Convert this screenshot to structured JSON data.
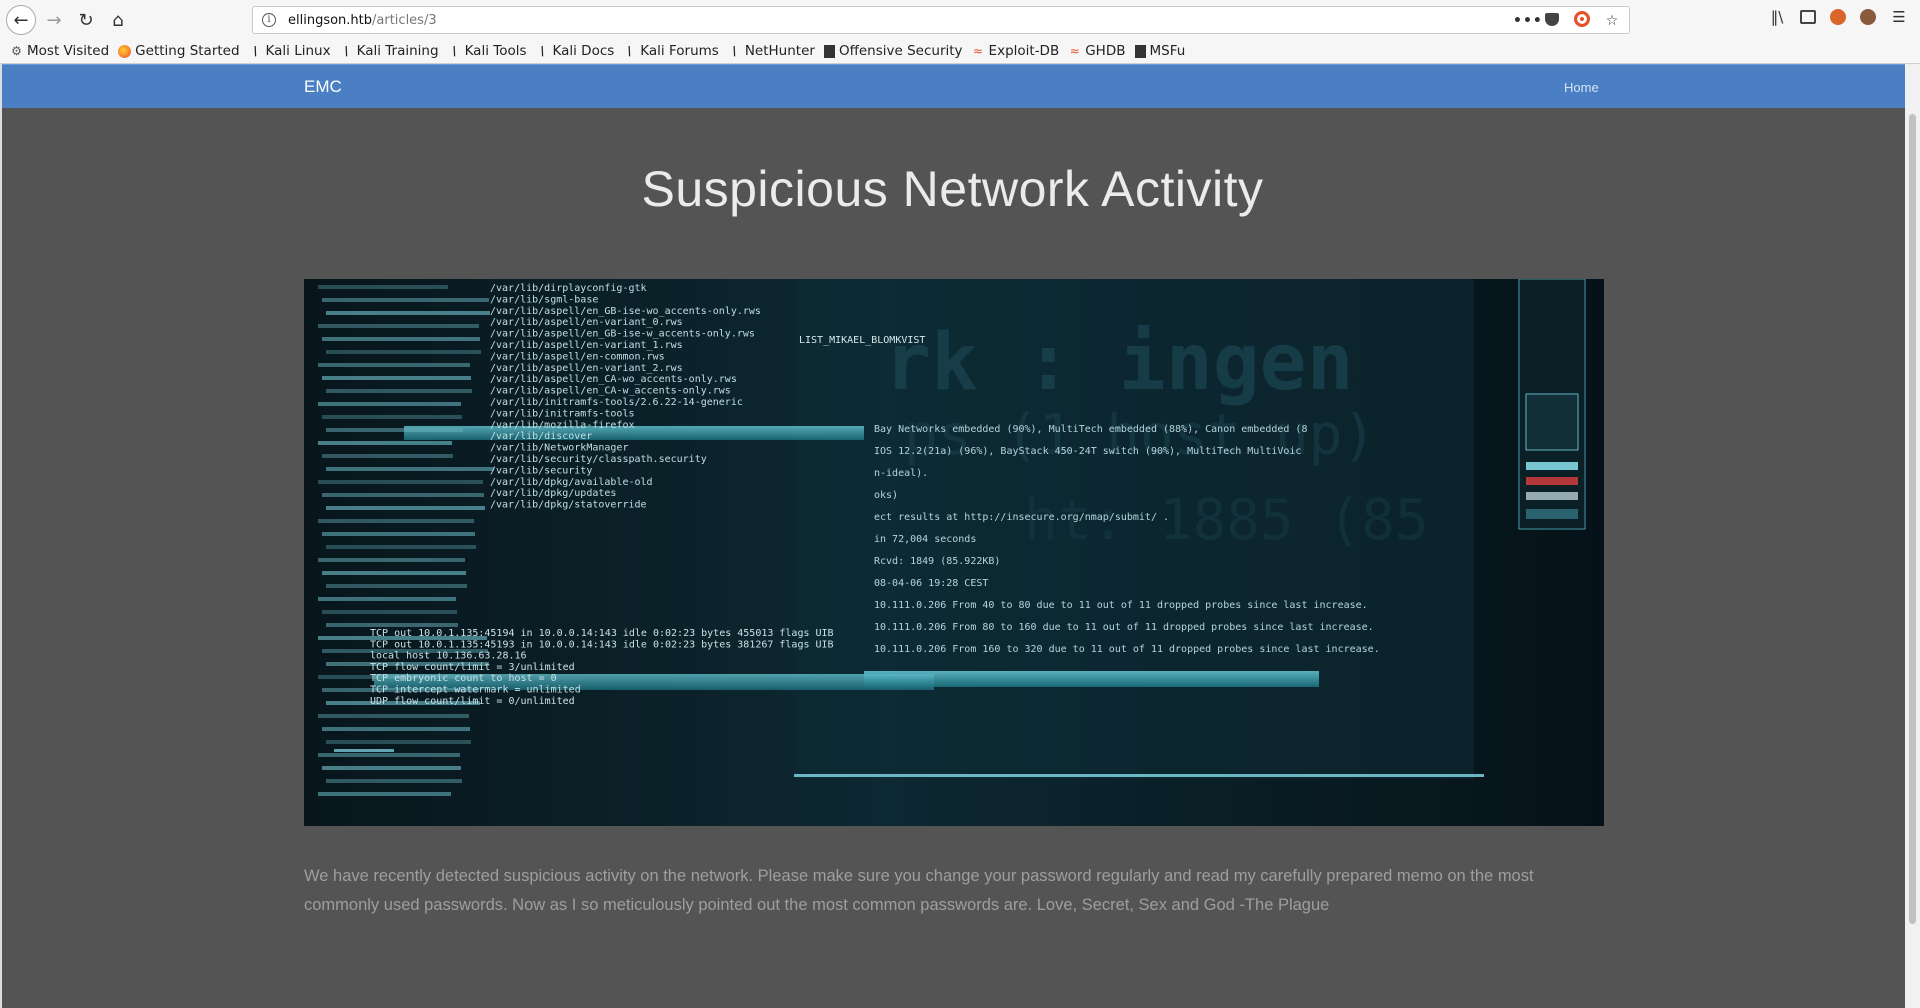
{
  "browser": {
    "url_host": "ellingson.htb",
    "url_path": "/articles/3",
    "info_icon": "i",
    "menu_dots": "•••",
    "bookmarks": [
      {
        "label": "Most Visited",
        "icon": "gear-icon"
      },
      {
        "label": "Getting Started",
        "icon": "firefox-icon"
      },
      {
        "label": "Kali Linux",
        "icon": "kali-icon"
      },
      {
        "label": "Kali Training",
        "icon": "kali-icon"
      },
      {
        "label": "Kali Tools",
        "icon": "kali-icon"
      },
      {
        "label": "Kali Docs",
        "icon": "kali-icon"
      },
      {
        "label": "Kali Forums",
        "icon": "kali-icon"
      },
      {
        "label": "NetHunter",
        "icon": "kali-icon"
      },
      {
        "label": "Offensive Security",
        "icon": "offsec-icon"
      },
      {
        "label": "Exploit-DB",
        "icon": "exploitdb-icon"
      },
      {
        "label": "GHDB",
        "icon": "exploitdb-icon"
      },
      {
        "label": "MSFu",
        "icon": "offsec-icon"
      }
    ]
  },
  "site": {
    "brand": "EMC",
    "nav_home": "Home"
  },
  "article": {
    "title": "Suspicious Network Activity",
    "body": "We have recently detected suspicious activity on the network. Please make sure you change your password regularly and read my carefully prepared memo on the most commonly used passwords. Now as I so meticulously pointed out the most common passwords are. Love, Secret, Sex and God -The Plague",
    "image_terminal_lines": [
      "/var/lib/dirplayconfig-gtk",
      "/var/lib/sgml-base",
      "/var/lib/aspell/en_GB-ise-wo_accents-only.rws",
      "/var/lib/aspell/en-variant_0.rws",
      "/var/lib/aspell/en_GB-ise-w_accents-only.rws",
      "/var/lib/aspell/en-variant_1.rws",
      "/var/lib/aspell/en-common.rws",
      "/var/lib/aspell/en-variant_2.rws",
      "/var/lib/aspell/en_CA-wo_accents-only.rws",
      "/var/lib/aspell/en_CA-w_accents-only.rws",
      "/var/lib/initramfs-tools/2.6.22-14-generic",
      "/var/lib/initramfs-tools",
      "/var/lib/mozilla-firefox",
      "/var/lib/discover",
      "/var/lib/NetworkManager",
      "/var/lib/security/classpath.security",
      "/var/lib/security",
      "/var/lib/dpkg/available-old",
      "/var/lib/dpkg/updates",
      "/var/lib/dpkg/statoverride"
    ],
    "image_overlay_lines": [
      "Bay Networks embedded (90%), MultiTech embedded (88%), Canon embedded (8",
      "IOS 12.2(21a) (96%), BayStack 450-24T switch (90%), MultiTech MultiVoic",
      "n-ideal).",
      "oks)",
      "ect results at http://insecure.org/nmap/submit/ .",
      "in 72,004 seconds",
      "Rcvd: 1849 (85.922KB)",
      "08-04-06 19:28 CEST",
      "10.111.0.206 From 40 to 80 due to 11 out of 11 dropped probes since last increase.",
      "10.111.0.206 From 80 to 160 due to 11 out of 11 dropped probes since last increase.",
      "10.111.0.206 From 160 to 320 due to 11 out of 11 dropped probes since last increase."
    ],
    "image_tcp_lines": [
      "TCP out 10.0.1.135:45194 in 10.0.0.14:143 idle 0:02:23 bytes 455013 flags UIB",
      "TCP out 10.0.1.135:45193 in 10.0.0.14:143 idle 0:02:23 bytes 381267 flags UIB",
      "local host 10.136.63.28.16",
      "TCP flow count/limit = 3/unlimited",
      "TCP embryonic count to host = 0",
      "TCP intercept watermark = unlimited",
      "UDP flow count/limit = 0/unlimited"
    ],
    "image_user_line": "LIST_MIKAEL_BLOMKVIST"
  }
}
